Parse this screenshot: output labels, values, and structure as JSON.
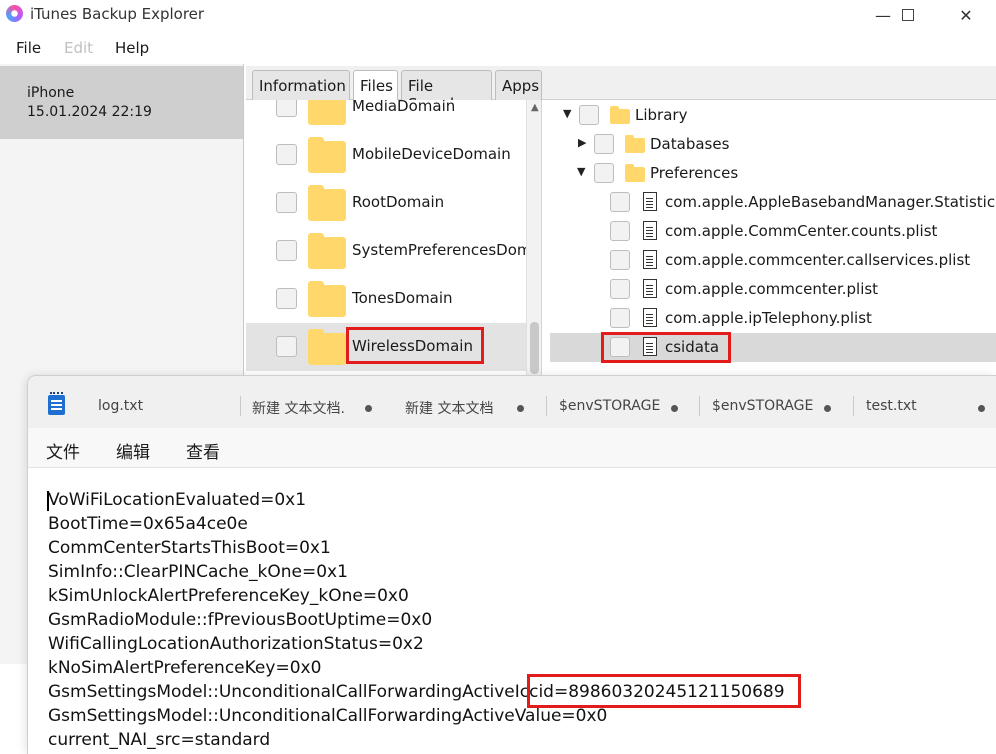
{
  "app": {
    "title": "iTunes Backup Explorer",
    "menu": {
      "file": "File",
      "edit": "Edit",
      "help": "Help"
    }
  },
  "device": {
    "name": "iPhone",
    "date": "15.01.2024 22:19"
  },
  "tabs": [
    {
      "label": "Information"
    },
    {
      "label": "Files"
    },
    {
      "label": "File Search"
    },
    {
      "label": "Apps"
    }
  ],
  "domains": [
    {
      "label": "MediaDomain"
    },
    {
      "label": "MobileDeviceDomain"
    },
    {
      "label": "RootDomain"
    },
    {
      "label": "SystemPreferencesDomain"
    },
    {
      "label": "TonesDomain"
    },
    {
      "label": "WirelessDomain"
    }
  ],
  "tree": [
    {
      "label": "Library",
      "kind": "folder",
      "expanded": true
    },
    {
      "label": "Databases",
      "kind": "folder",
      "expanded": false
    },
    {
      "label": "Preferences",
      "kind": "folder",
      "expanded": true
    },
    {
      "label": "com.apple.AppleBasebandManager.Statistics.plist",
      "kind": "file"
    },
    {
      "label": "com.apple.CommCenter.counts.plist",
      "kind": "file"
    },
    {
      "label": "com.apple.commcenter.callservices.plist",
      "kind": "file"
    },
    {
      "label": "com.apple.commcenter.plist",
      "kind": "file"
    },
    {
      "label": "com.apple.ipTelephony.plist",
      "kind": "file"
    },
    {
      "label": "csidata",
      "kind": "file"
    }
  ],
  "notepad": {
    "tabs": [
      {
        "label": "log.txt"
      },
      {
        "label": "新建 文本文档."
      },
      {
        "label": "新建 文本文档"
      },
      {
        "label": "$envSTORAGE"
      },
      {
        "label": "$envSTORAGE"
      },
      {
        "label": "test.txt"
      }
    ],
    "menu": {
      "file": "文件",
      "edit": "编辑",
      "view": "查看"
    },
    "lines": [
      "VoWiFiLocationEvaluated=0x1",
      "BootTime=0x65a4ce0e",
      "CommCenterStartsThisBoot=0x1",
      "SimInfo::ClearPINCache_kOne=0x1",
      "kSimUnlockAlertPreferenceKey_kOne=0x0",
      "GsmRadioModule::fPreviousBootUptime=0x0",
      "WifiCallingLocationAuthorizationStatus=0x2",
      "kNoSimAlertPreferenceKey=0x0",
      "GsmSettingsModel::UnconditionalCallForwardingActiveIccid=89860320245121150689",
      "GsmSettingsModel::UnconditionalCallForwardingActiveValue=0x0",
      "current_NAI_src=standard"
    ]
  },
  "colors": {
    "highlight_box": "#e21b1b",
    "folder": "#ffd76a",
    "notepad_icon": "#1e6fd0"
  }
}
